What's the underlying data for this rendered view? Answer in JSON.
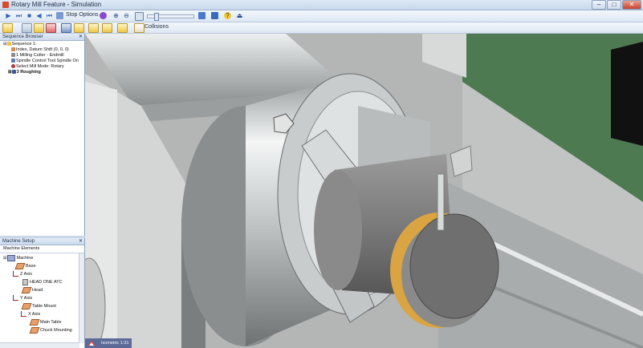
{
  "window": {
    "title": "Rotary Mill Feature - Simulation",
    "minimize": "–",
    "maximize": "□",
    "close": "✕"
  },
  "toolbar": {
    "stop_options_label": "Stop Options",
    "collisions_label": "Collisions"
  },
  "sequence_browser": {
    "title": "Sequence Browser",
    "items": [
      {
        "label": "Sequence 1:",
        "bold": false
      },
      {
        "label": "Index, Datum Shift (0, 0, 0)",
        "bold": false
      },
      {
        "label": "1 Milling Cutter - Endmill",
        "bold": false
      },
      {
        "label": "Spindle Control Tool Spindle On",
        "bold": false
      },
      {
        "label": "Select Mill Mode: Rotary",
        "bold": false
      },
      {
        "label": "3 Roughing",
        "bold": true
      }
    ]
  },
  "machine_setup": {
    "title": "Machine Setup",
    "elements_header": "Machine Elements",
    "items": [
      {
        "label": "Machine",
        "type": "machine"
      },
      {
        "label": "Base",
        "type": "part"
      },
      {
        "label": "Z Axis",
        "type": "axis"
      },
      {
        "label": "HEAD ONE ATC",
        "type": "tool"
      },
      {
        "label": "Head",
        "type": "part"
      },
      {
        "label": "Y Axis",
        "type": "axis"
      },
      {
        "label": "Table Mount",
        "type": "part"
      },
      {
        "label": "X Axis",
        "type": "axis"
      },
      {
        "label": "Main Table",
        "type": "part"
      },
      {
        "label": "Chuck Mounting",
        "type": "part"
      }
    ]
  },
  "status_bar": {
    "view_label": "Isometric 1:31"
  },
  "colors": {
    "viewport_green": "#4e7a52",
    "chuck_metal": "#c9cccc",
    "stock_gray": "#7b7b7b",
    "cut_gold": "#d9a441"
  }
}
